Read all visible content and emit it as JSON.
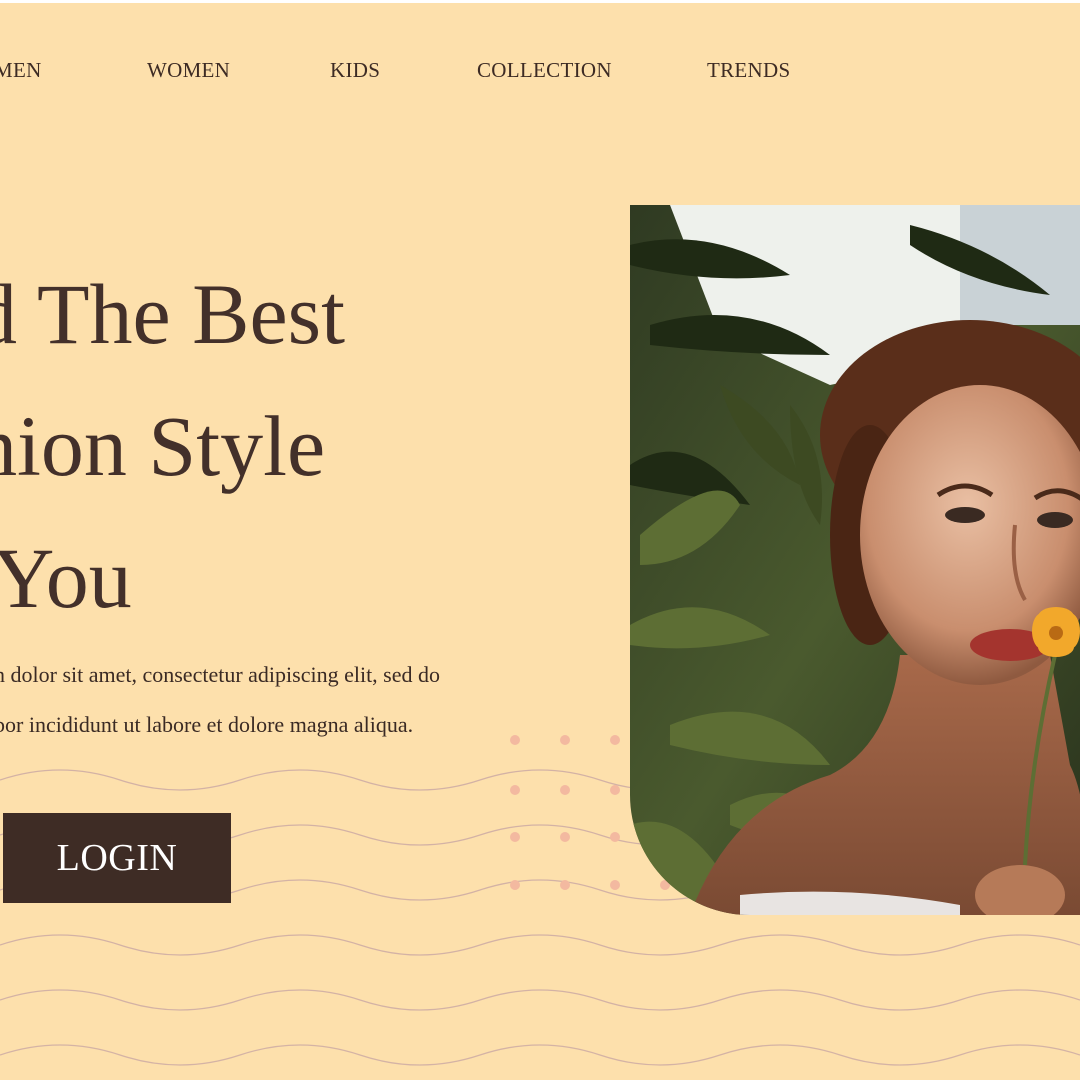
{
  "nav": {
    "items": [
      {
        "label": "MEN"
      },
      {
        "label": "WOMEN"
      },
      {
        "label": "KIDS"
      },
      {
        "label": "COLLECTION"
      },
      {
        "label": "TRENDS"
      }
    ]
  },
  "hero": {
    "title_lines": [
      "d The Best",
      "hion Style",
      " You"
    ],
    "description_lines": [
      "n dolor sit amet, consectetur adipiscing elit, sed do",
      "por incididunt ut labore et dolore magna aliqua."
    ],
    "login_label": "LOGIN"
  },
  "colors": {
    "background": "#fde0ac",
    "text": "#3d2b24",
    "button": "#3e2c25",
    "dots": "#f3b9a0",
    "waves": "#c9a7a4"
  }
}
